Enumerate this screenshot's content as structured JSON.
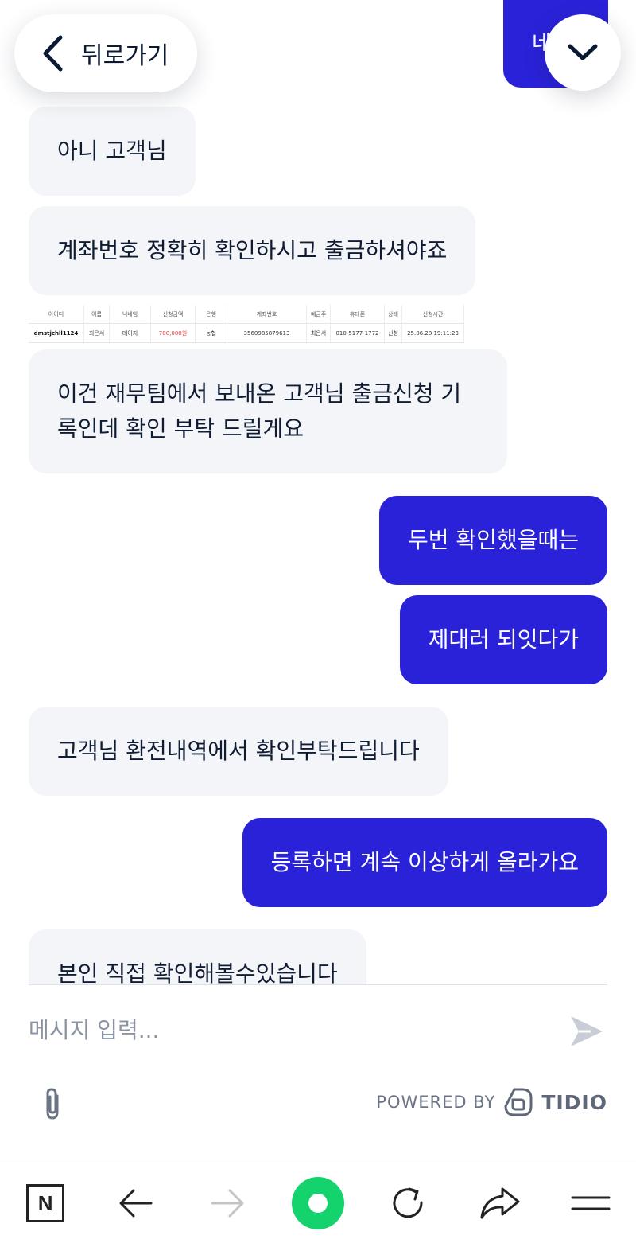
{
  "header": {
    "back_label": "뒤로가기",
    "partial_top_text": "네"
  },
  "messages": [
    {
      "sender": "operator",
      "text": "아니 고객님"
    },
    {
      "sender": "operator",
      "text": "계좌번호 정확히 확인하시고 출금하셔야죠"
    },
    {
      "sender": "operator",
      "text": "이건 재무팀에서 보내온 고객님 출금신청 기록인데 확인 부탁 드릴게요"
    },
    {
      "sender": "visitor",
      "text": "두번 확인했을때는"
    },
    {
      "sender": "visitor",
      "text": "제대러 되잇다가"
    },
    {
      "sender": "operator",
      "text": "고객님 환전내역에서 확인부탁드립니다"
    },
    {
      "sender": "visitor",
      "text": "등록하면 계속 이상하게 올라가요"
    },
    {
      "sender": "operator",
      "text": "본인 직접 확인해볼수있습니다"
    }
  ],
  "record_image": {
    "headers": [
      "아이디",
      "이름",
      "닉네임",
      "신청금액",
      "은행",
      "계좌번호",
      "예금주",
      "휴대폰",
      "상태",
      "신청시간"
    ],
    "row": [
      "dmstjchll1124",
      "최은서",
      "데이지",
      "700,000원",
      "농협",
      "3560985879613",
      "최은서",
      "010-5177-1772",
      "신청",
      "25.06.28 19:11:23"
    ]
  },
  "composer": {
    "placeholder": "메시지 입력...",
    "powered_by": "POWERED BY",
    "brand": "TIDIO"
  },
  "browser_nav": {
    "home_label": "N"
  },
  "colors": {
    "visitor_bubble": "#2a22d8",
    "operator_bubble": "#f4f5f8",
    "home_green": "#14d36c"
  }
}
